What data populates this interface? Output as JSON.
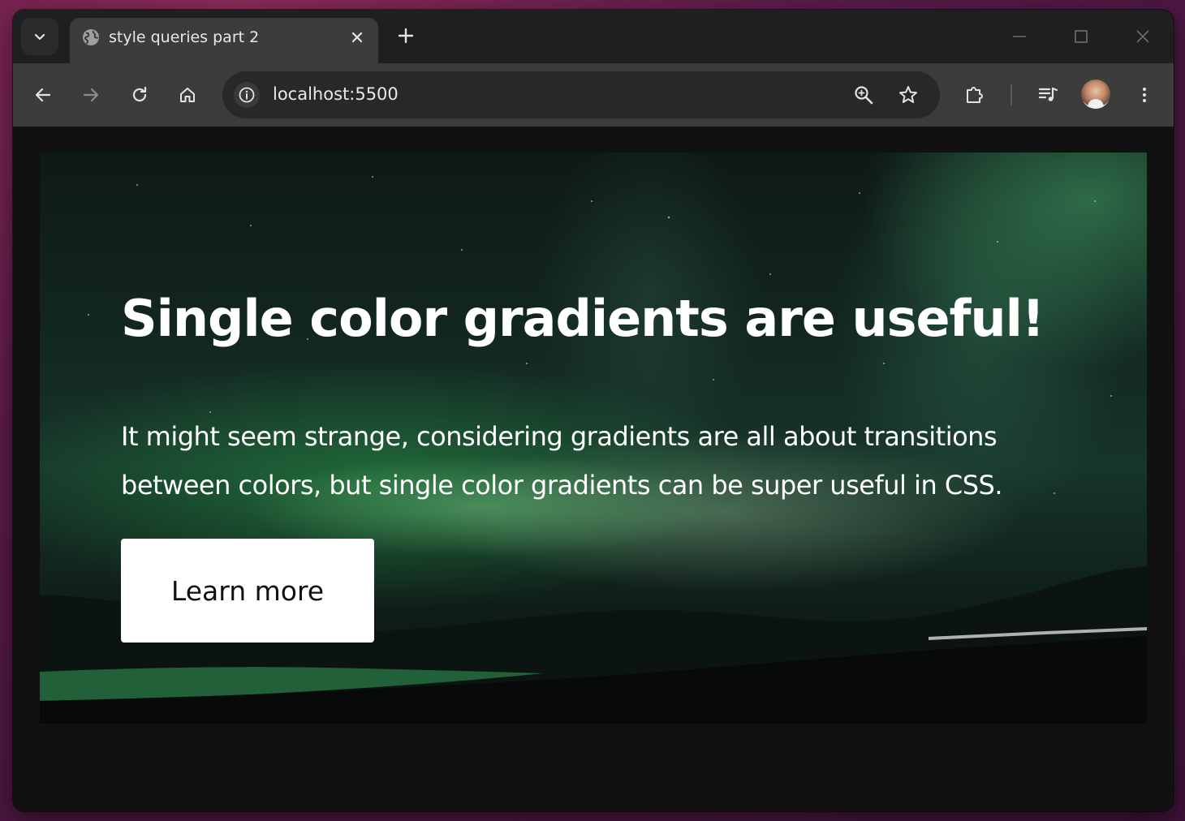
{
  "browser": {
    "tab_title": "style queries part 2",
    "url": "localhost:5500",
    "icons": {
      "tab_search": "chevron-down-icon",
      "tab_favicon": "globe-icon",
      "tab_close": "close-icon",
      "new_tab": "plus-icon",
      "minimize": "minimize-icon",
      "maximize": "maximize-icon",
      "close_window": "close-icon",
      "back": "arrow-left-icon",
      "forward": "arrow-right-icon",
      "reload": "reload-icon",
      "home": "home-icon",
      "site_info": "info-icon",
      "zoom": "zoom-icon",
      "bookmark": "star-icon",
      "extensions": "puzzle-icon",
      "media": "media-queue-icon",
      "profile": "avatar",
      "menu": "kebab-menu-icon"
    },
    "colors": {
      "frame": "#1e1f20",
      "toolbar": "#3c3c3c",
      "omnibox": "#282828",
      "page_background": "#111111"
    }
  },
  "page": {
    "heading": "Single color gradients are useful!",
    "body": "It might seem strange, considering gradients are all about transitions between colors, but single color gradients can be super useful in CSS.",
    "button_label": "Learn more",
    "colors": {
      "text": "#ffffff",
      "button_bg": "#ffffff",
      "button_text": "#111111"
    }
  }
}
